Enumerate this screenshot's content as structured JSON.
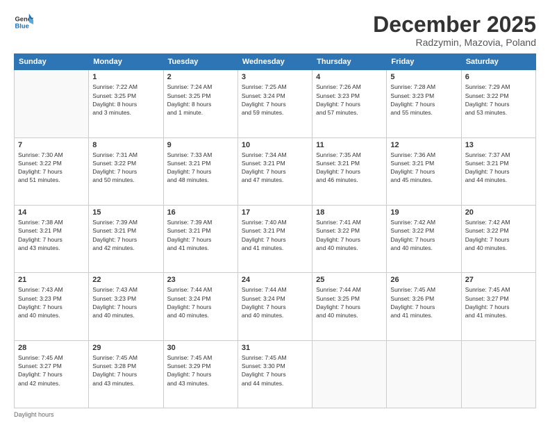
{
  "header": {
    "logo_line1": "General",
    "logo_line2": "Blue",
    "month_title": "December 2025",
    "location": "Radzymin, Mazovia, Poland"
  },
  "days_of_week": [
    "Sunday",
    "Monday",
    "Tuesday",
    "Wednesday",
    "Thursday",
    "Friday",
    "Saturday"
  ],
  "weeks": [
    [
      {
        "day": "",
        "info": ""
      },
      {
        "day": "1",
        "info": "Sunrise: 7:22 AM\nSunset: 3:25 PM\nDaylight: 8 hours\nand 3 minutes."
      },
      {
        "day": "2",
        "info": "Sunrise: 7:24 AM\nSunset: 3:25 PM\nDaylight: 8 hours\nand 1 minute."
      },
      {
        "day": "3",
        "info": "Sunrise: 7:25 AM\nSunset: 3:24 PM\nDaylight: 7 hours\nand 59 minutes."
      },
      {
        "day": "4",
        "info": "Sunrise: 7:26 AM\nSunset: 3:23 PM\nDaylight: 7 hours\nand 57 minutes."
      },
      {
        "day": "5",
        "info": "Sunrise: 7:28 AM\nSunset: 3:23 PM\nDaylight: 7 hours\nand 55 minutes."
      },
      {
        "day": "6",
        "info": "Sunrise: 7:29 AM\nSunset: 3:22 PM\nDaylight: 7 hours\nand 53 minutes."
      }
    ],
    [
      {
        "day": "7",
        "info": "Sunrise: 7:30 AM\nSunset: 3:22 PM\nDaylight: 7 hours\nand 51 minutes."
      },
      {
        "day": "8",
        "info": "Sunrise: 7:31 AM\nSunset: 3:22 PM\nDaylight: 7 hours\nand 50 minutes."
      },
      {
        "day": "9",
        "info": "Sunrise: 7:33 AM\nSunset: 3:21 PM\nDaylight: 7 hours\nand 48 minutes."
      },
      {
        "day": "10",
        "info": "Sunrise: 7:34 AM\nSunset: 3:21 PM\nDaylight: 7 hours\nand 47 minutes."
      },
      {
        "day": "11",
        "info": "Sunrise: 7:35 AM\nSunset: 3:21 PM\nDaylight: 7 hours\nand 46 minutes."
      },
      {
        "day": "12",
        "info": "Sunrise: 7:36 AM\nSunset: 3:21 PM\nDaylight: 7 hours\nand 45 minutes."
      },
      {
        "day": "13",
        "info": "Sunrise: 7:37 AM\nSunset: 3:21 PM\nDaylight: 7 hours\nand 44 minutes."
      }
    ],
    [
      {
        "day": "14",
        "info": "Sunrise: 7:38 AM\nSunset: 3:21 PM\nDaylight: 7 hours\nand 43 minutes."
      },
      {
        "day": "15",
        "info": "Sunrise: 7:39 AM\nSunset: 3:21 PM\nDaylight: 7 hours\nand 42 minutes."
      },
      {
        "day": "16",
        "info": "Sunrise: 7:39 AM\nSunset: 3:21 PM\nDaylight: 7 hours\nand 41 minutes."
      },
      {
        "day": "17",
        "info": "Sunrise: 7:40 AM\nSunset: 3:21 PM\nDaylight: 7 hours\nand 41 minutes."
      },
      {
        "day": "18",
        "info": "Sunrise: 7:41 AM\nSunset: 3:22 PM\nDaylight: 7 hours\nand 40 minutes."
      },
      {
        "day": "19",
        "info": "Sunrise: 7:42 AM\nSunset: 3:22 PM\nDaylight: 7 hours\nand 40 minutes."
      },
      {
        "day": "20",
        "info": "Sunrise: 7:42 AM\nSunset: 3:22 PM\nDaylight: 7 hours\nand 40 minutes."
      }
    ],
    [
      {
        "day": "21",
        "info": "Sunrise: 7:43 AM\nSunset: 3:23 PM\nDaylight: 7 hours\nand 40 minutes."
      },
      {
        "day": "22",
        "info": "Sunrise: 7:43 AM\nSunset: 3:23 PM\nDaylight: 7 hours\nand 40 minutes."
      },
      {
        "day": "23",
        "info": "Sunrise: 7:44 AM\nSunset: 3:24 PM\nDaylight: 7 hours\nand 40 minutes."
      },
      {
        "day": "24",
        "info": "Sunrise: 7:44 AM\nSunset: 3:24 PM\nDaylight: 7 hours\nand 40 minutes."
      },
      {
        "day": "25",
        "info": "Sunrise: 7:44 AM\nSunset: 3:25 PM\nDaylight: 7 hours\nand 40 minutes."
      },
      {
        "day": "26",
        "info": "Sunrise: 7:45 AM\nSunset: 3:26 PM\nDaylight: 7 hours\nand 41 minutes."
      },
      {
        "day": "27",
        "info": "Sunrise: 7:45 AM\nSunset: 3:27 PM\nDaylight: 7 hours\nand 41 minutes."
      }
    ],
    [
      {
        "day": "28",
        "info": "Sunrise: 7:45 AM\nSunset: 3:27 PM\nDaylight: 7 hours\nand 42 minutes."
      },
      {
        "day": "29",
        "info": "Sunrise: 7:45 AM\nSunset: 3:28 PM\nDaylight: 7 hours\nand 43 minutes."
      },
      {
        "day": "30",
        "info": "Sunrise: 7:45 AM\nSunset: 3:29 PM\nDaylight: 7 hours\nand 43 minutes."
      },
      {
        "day": "31",
        "info": "Sunrise: 7:45 AM\nSunset: 3:30 PM\nDaylight: 7 hours\nand 44 minutes."
      },
      {
        "day": "",
        "info": ""
      },
      {
        "day": "",
        "info": ""
      },
      {
        "day": "",
        "info": ""
      }
    ]
  ],
  "footer": {
    "note": "Daylight hours"
  }
}
